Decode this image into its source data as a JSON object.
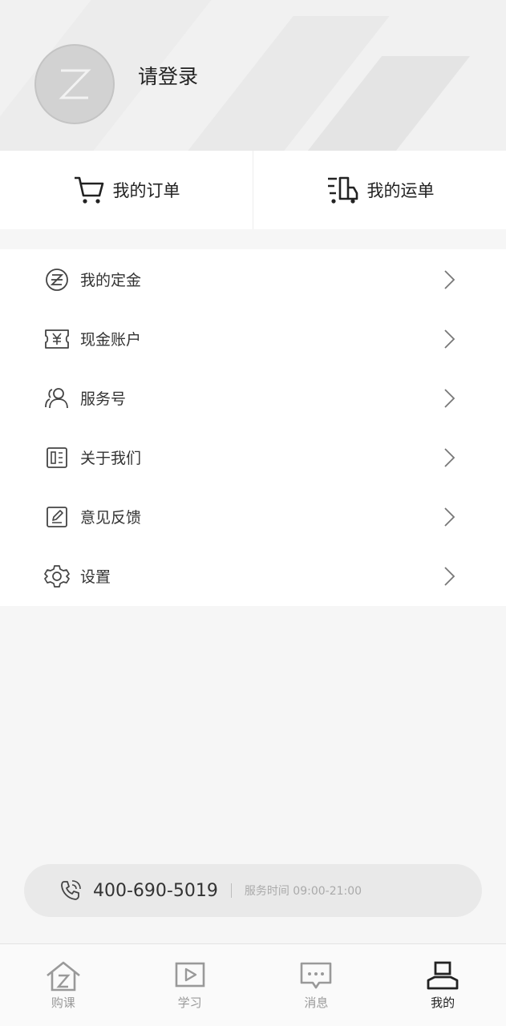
{
  "header": {
    "avatar_letter": "Z",
    "login_text": "请登录"
  },
  "quick_actions": [
    {
      "label": "我的订单",
      "icon": "cart-icon"
    },
    {
      "label": "我的运单",
      "icon": "truck-icon"
    }
  ],
  "menu": [
    {
      "label": "我的定金",
      "icon": "deposit-icon"
    },
    {
      "label": "现金账户",
      "icon": "cash-icon"
    },
    {
      "label": "服务号",
      "icon": "users-icon"
    },
    {
      "label": "关于我们",
      "icon": "about-icon"
    },
    {
      "label": "意见反馈",
      "icon": "feedback-icon"
    },
    {
      "label": "设置",
      "icon": "gear-icon"
    }
  ],
  "hotline": {
    "number": "400-690-5019",
    "hours": "服务时间 09:00-21:00"
  },
  "tabs": [
    {
      "label": "购课",
      "icon": "home-icon",
      "active": false
    },
    {
      "label": "学习",
      "icon": "play-icon",
      "active": false
    },
    {
      "label": "消息",
      "icon": "message-icon",
      "active": false
    },
    {
      "label": "我的",
      "icon": "profile-icon",
      "active": true
    }
  ],
  "colors": {
    "active_tab": "#222222",
    "inactive_tab": "#999999",
    "background": "#f6f6f6"
  }
}
